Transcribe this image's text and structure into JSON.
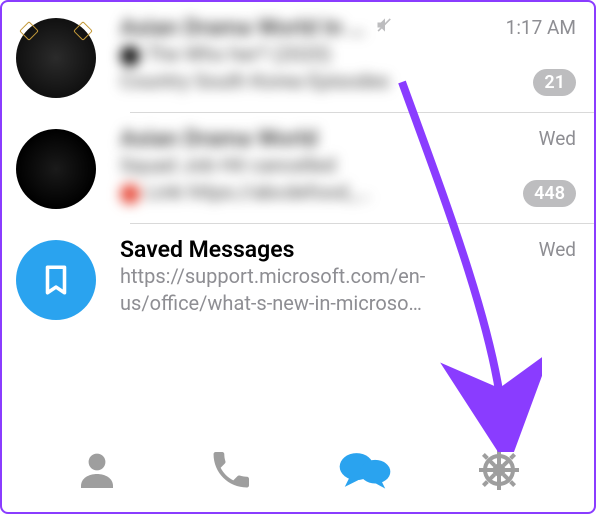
{
  "chats": [
    {
      "title": "Asian Drama World In …",
      "muted": true,
      "time": "1:17 AM",
      "preview_l1": "The  Who her? (2020)",
      "preview_l2": "Country  South Korea  Episodes",
      "badge": "21"
    },
    {
      "title": "Asian Drama World",
      "muted": false,
      "time": "Wed",
      "preview_l1": "Squad Job Hit cancelled",
      "preview_l2": "Link  https://abcdefood_…",
      "badge": "448"
    },
    {
      "title": "Saved Messages",
      "muted": false,
      "time": "Wed",
      "preview": "https://support.microsoft.com/en-us/office/what-s-new-in-microso…",
      "badge": ""
    }
  ],
  "tabs": {
    "contacts": "contacts-icon",
    "calls": "calls-icon",
    "chats": "chats-icon",
    "settings": "settings-icon"
  }
}
